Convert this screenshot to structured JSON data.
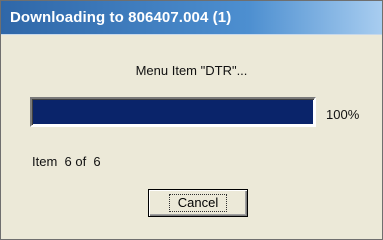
{
  "window": {
    "title": "Downloading to 806407.004 (1)"
  },
  "status": {
    "message": "Menu Item \"DTR\"..."
  },
  "progress": {
    "value": 1.0,
    "label": "100%"
  },
  "item_count": {
    "text": "Item  6 of  6"
  },
  "buttons": {
    "cancel_label": "Cancel"
  },
  "colors": {
    "progress_fill": "#0a246a",
    "title_start": "#2f67a8",
    "title_end": "#a8cdf0",
    "dialog_background": "#ece9d8"
  }
}
